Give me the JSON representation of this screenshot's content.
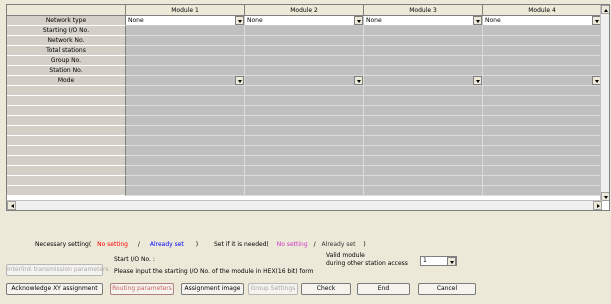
{
  "grid": {
    "columns": [
      "Module 1",
      "Module 2",
      "Module 3",
      "Module 4"
    ],
    "rows": [
      {
        "label": "Network type",
        "type": "dropdown",
        "values": [
          "None",
          "None",
          "None",
          "None"
        ]
      },
      {
        "label": "Starting I/O No.",
        "type": "text"
      },
      {
        "label": "Network No.",
        "type": "text"
      },
      {
        "label": "Total stations",
        "type": "text"
      },
      {
        "label": "Group No.",
        "type": "text"
      },
      {
        "label": "Station No.",
        "type": "text"
      },
      {
        "label": "Mode",
        "type": "dropdown-empty"
      },
      {
        "label": "",
        "type": "text"
      },
      {
        "label": "",
        "type": "text"
      },
      {
        "label": "",
        "type": "text"
      },
      {
        "label": "",
        "type": "text"
      },
      {
        "label": "",
        "type": "text"
      },
      {
        "label": "",
        "type": "text"
      },
      {
        "label": "",
        "type": "text"
      },
      {
        "label": "",
        "type": "text"
      },
      {
        "label": "",
        "type": "text"
      },
      {
        "label": "",
        "type": "text"
      },
      {
        "label": "",
        "type": "text"
      }
    ]
  },
  "legend": {
    "necessary_prefix": "Necessary setting(",
    "no_setting": "No setting",
    "slash1": "/",
    "already_set": "Already set",
    "close1": ")",
    "if_needed_prefix": "Set if it is needed(",
    "no_setting2": "No setting",
    "slash2": "/",
    "already_set2": "Already set",
    "close2": ")",
    "colors": {
      "red": "#ff0000",
      "blue": "#0000ff",
      "purple": "#cc33cc",
      "gray": "#333333"
    }
  },
  "info": {
    "start_io_label": "Start I/O No. :",
    "hint": "Please input the starting I/O No. of the module in HEX(16 bit) form",
    "valid_module_label_1": "Valid module",
    "valid_module_label_2": "during other station access",
    "valid_module_value": "1"
  },
  "buttons": {
    "interlink": "Interlink transmission parameters",
    "acknowledge": "Acknowledge XY assignment",
    "routing": "Routing parameters",
    "assignment_image": "Assignment image",
    "group_settings": "Group Settings",
    "check": "Check",
    "end": "End",
    "cancel": "Cancel"
  }
}
